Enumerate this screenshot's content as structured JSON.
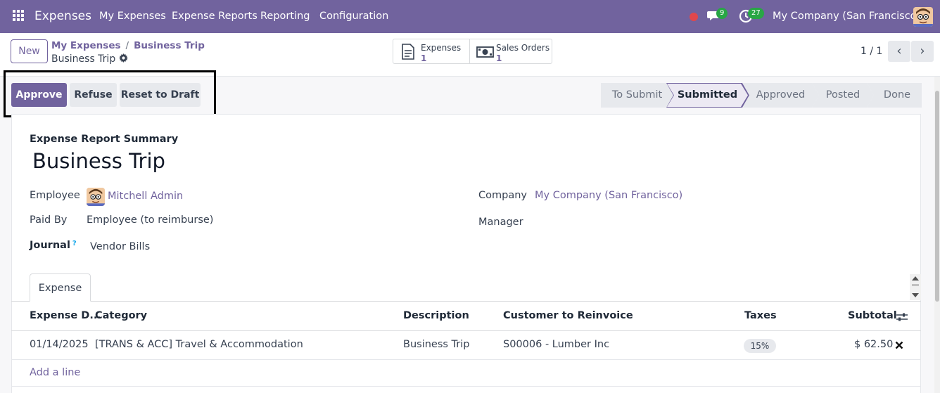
{
  "nav": {
    "app_name": "Expenses",
    "menu": [
      "My Expenses",
      "Expense Reports",
      "Reporting",
      "Configuration"
    ],
    "chat_count": "9",
    "activity_count": "27",
    "company": "My Company (San Francisco)"
  },
  "control": {
    "new_label": "New",
    "breadcrumb": [
      "My Expenses",
      "Business Trip"
    ],
    "record_name": "Business Trip",
    "smart_buttons": [
      {
        "label": "Expenses",
        "count": "1"
      },
      {
        "label": "Sales Orders",
        "count": "1"
      }
    ],
    "pager": "1 / 1"
  },
  "actions": {
    "approve": "Approve",
    "refuse": "Refuse",
    "reset": "Reset to Draft"
  },
  "stages": [
    "To Submit",
    "Submitted",
    "Approved",
    "Posted",
    "Done"
  ],
  "active_stage": "Submitted",
  "form": {
    "summary_label": "Expense Report Summary",
    "title": "Business Trip",
    "employee_label": "Employee",
    "employee": "Mitchell Admin",
    "paid_by_label": "Paid By",
    "paid_by": "Employee (to reimburse)",
    "journal_label": "Journal",
    "journal_help": "?",
    "journal": "Vendor Bills",
    "company_label": "Company",
    "company": "My Company (San Francisco)",
    "manager_label": "Manager"
  },
  "tab": "Expense",
  "table": {
    "headers": [
      "Expense D...",
      "Category",
      "Description",
      "Customer to Reinvoice",
      "Taxes",
      "Subtotal"
    ],
    "rows": [
      {
        "date": "01/14/2025",
        "category": "[TRANS & ACC] Travel & Accommodation",
        "description": "Business Trip",
        "customer": "S00006 - Lumber Inc",
        "tax": "15%",
        "subtotal": "$ 62.50"
      }
    ],
    "add_line": "Add a line"
  },
  "colors": {
    "brand": "#71639e",
    "badge": "#28a745",
    "record_dot": "#e0474c"
  }
}
